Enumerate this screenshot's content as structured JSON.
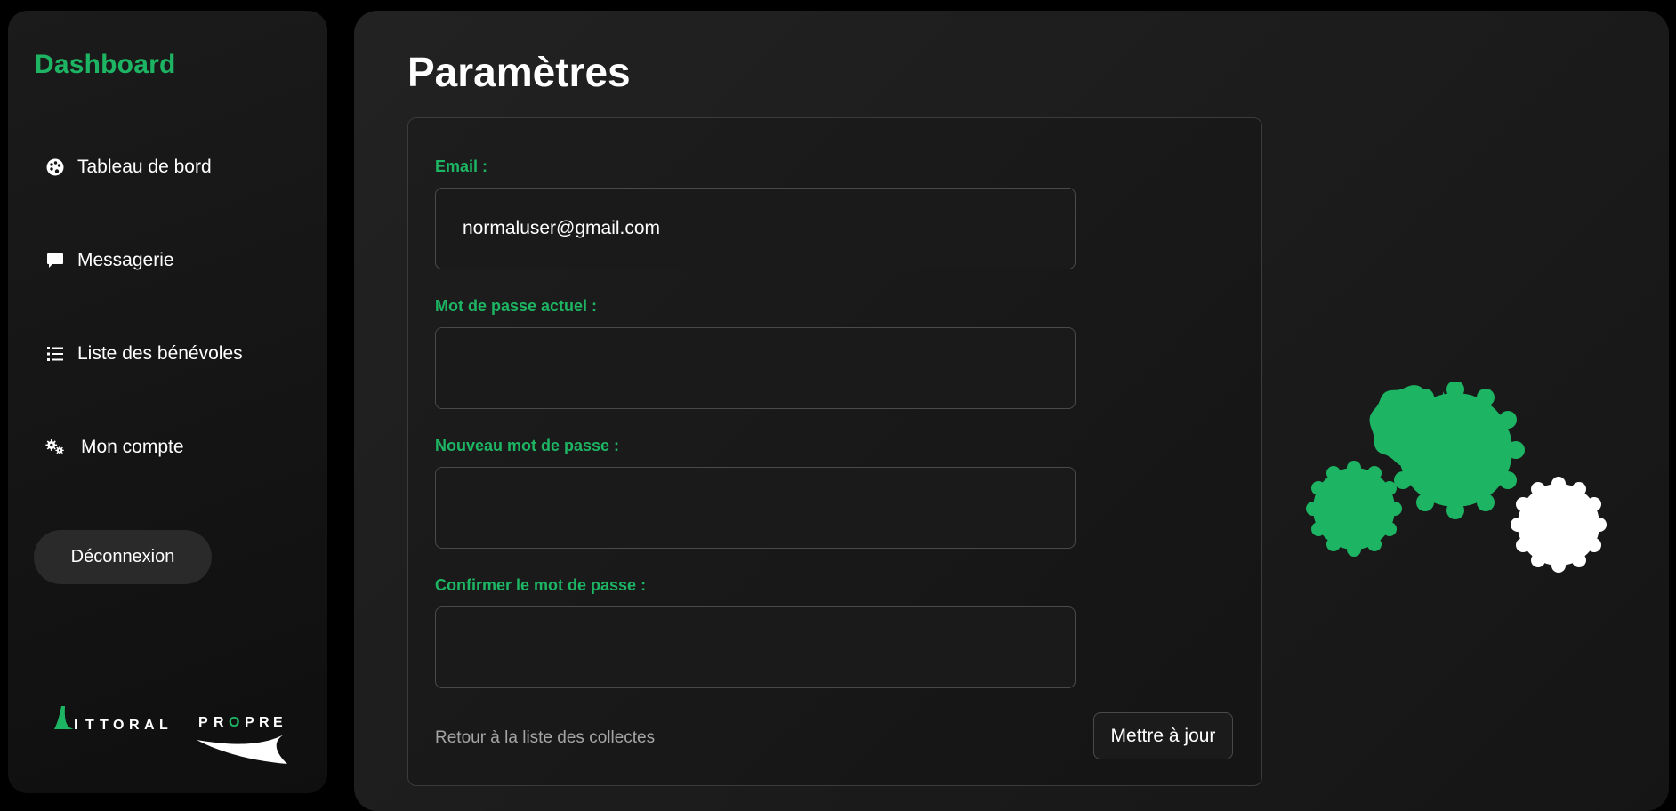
{
  "sidebar": {
    "brand": "Dashboard",
    "items": [
      {
        "label": "Tableau de bord",
        "icon": "palette-icon"
      },
      {
        "label": "Messagerie",
        "icon": "message-icon"
      },
      {
        "label": "Liste des bénévoles",
        "icon": "list-icon"
      },
      {
        "label": "Mon compte",
        "icon": "gears-icon"
      }
    ],
    "logout_label": "Déconnexion",
    "logo_text": "LITTORAL PROPRE"
  },
  "main": {
    "title": "Paramètres",
    "form": {
      "email_label": "Email :",
      "email_value": "normaluser@gmail.com",
      "current_password_label": "Mot de passe actuel :",
      "current_password_value": "",
      "new_password_label": "Nouveau mot de passe :",
      "new_password_value": "",
      "confirm_password_label": "Confirmer le mot de passe :",
      "confirm_password_value": "",
      "back_link": "Retour à la liste des collectes",
      "submit_label": "Mettre à jour"
    }
  },
  "colors": {
    "accent": "#1db563",
    "background": "#000000",
    "panel": "#1e1e1e",
    "muted_text": "#a5a5a5"
  }
}
